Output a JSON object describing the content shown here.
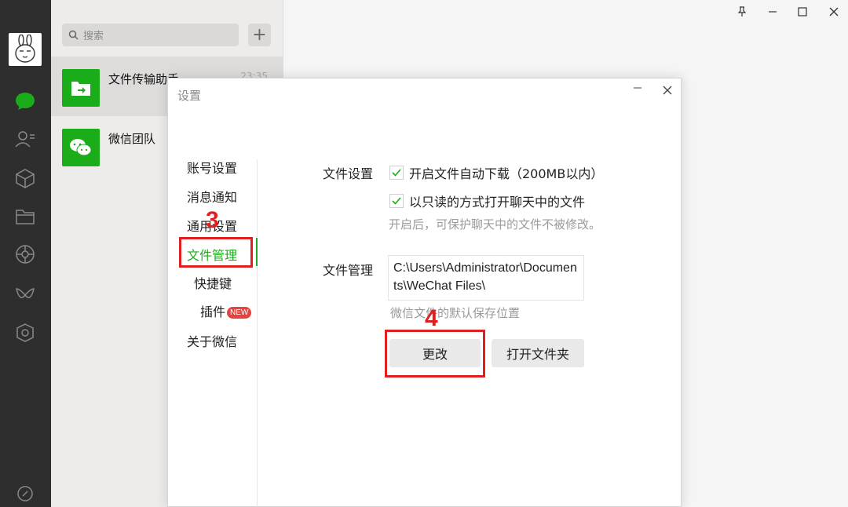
{
  "search": {
    "placeholder": "搜索"
  },
  "chats": [
    {
      "name": "文件传输助手",
      "time": "23:35"
    },
    {
      "name": "微信团队"
    }
  ],
  "dialog": {
    "title": "设置",
    "menu": [
      "账号设置",
      "消息通知",
      "通用设置",
      "文件管理",
      "快捷键",
      "插件",
      "关于微信"
    ],
    "menu_badge": "NEW",
    "file_settings": {
      "label": "文件设置",
      "auto_download": "开启文件自动下载（200MB以内）",
      "readonly_open": "以只读的方式打开聊天中的文件",
      "readonly_hint": "开启后，可保护聊天中的文件不被修改。"
    },
    "file_management": {
      "label": "文件管理",
      "path": "C:\\Users\\Administrator\\Documents\\WeChat Files\\",
      "path_hint": "微信文件的默认保存位置",
      "change_button": "更改",
      "open_folder_button": "打开文件夹"
    }
  },
  "annotations": {
    "step3": "3",
    "step4": "4"
  },
  "colors": {
    "accent": "#1aad19",
    "annotation": "#e02020",
    "nav_bg": "#2e2e2e"
  }
}
